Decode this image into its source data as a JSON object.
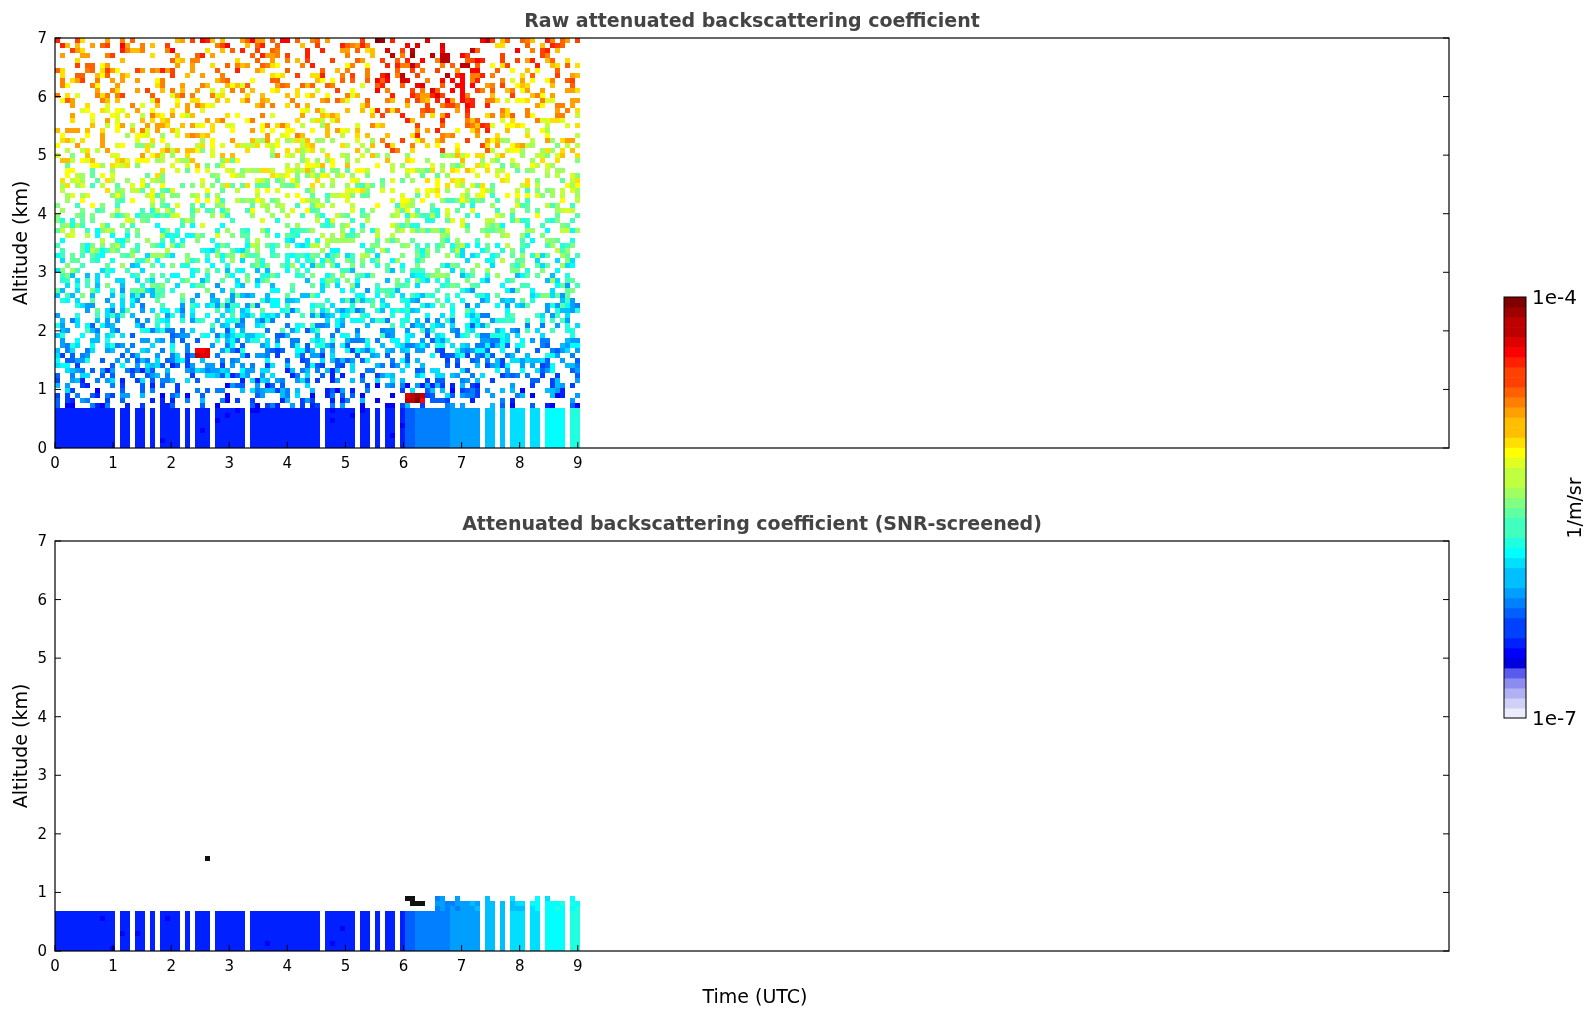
{
  "figure": {
    "panels": [
      {
        "title": "Raw attenuated backscattering coefficient",
        "ylabel": "Altitude (km)",
        "yticks": [
          "7",
          "6",
          "5",
          "4",
          "3",
          "2",
          "1",
          "0"
        ],
        "xticks": [
          "0",
          "1",
          "2",
          "3",
          "4",
          "5",
          "6",
          "7",
          "8",
          "9"
        ],
        "screened": false
      },
      {
        "title": "Attenuated backscattering coefficient (SNR-screened)",
        "ylabel": "Altitude (km)",
        "yticks": [
          "7",
          "6",
          "5",
          "4",
          "3",
          "2",
          "1",
          "0"
        ],
        "xticks": [
          "0",
          "1",
          "2",
          "3",
          "4",
          "5",
          "6",
          "7",
          "8",
          "9"
        ],
        "screened": true,
        "xlabel": "Time (UTC)"
      }
    ],
    "colorbar": {
      "label": "1/m/sr",
      "max_label": "1e-4",
      "min_label": "1e-7"
    }
  }
}
